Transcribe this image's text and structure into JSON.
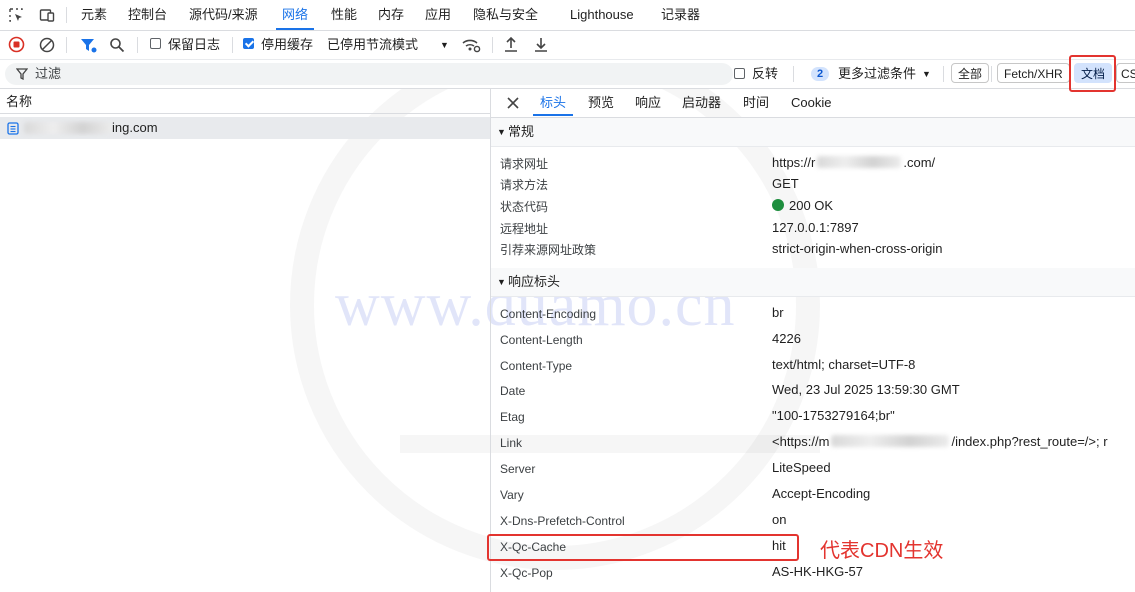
{
  "top_tabs": [
    "元素",
    "控制台",
    "源代码/来源",
    "网络",
    "性能",
    "内存",
    "应用",
    "隐私与安全",
    "Lighthouse",
    "记录器"
  ],
  "active_top_tab": "网络",
  "toolbar": {
    "preserve_log": "保留日志",
    "disable_cache": "停用缓存",
    "throttle": "已停用节流模式"
  },
  "filter": {
    "label": "过滤",
    "invert": "反转",
    "more_count": "2",
    "more_filters": "更多过滤条件",
    "types": [
      "全部",
      "Fetch/XHR",
      "文档",
      "CS"
    ],
    "active_type": "文档"
  },
  "request_list": {
    "column": "名称",
    "rows": [
      {
        "name_suffix": "ing.com"
      }
    ]
  },
  "detail_tabs": [
    "标头",
    "预览",
    "响应",
    "启动器",
    "时间",
    "Cookie"
  ],
  "active_detail_tab": "标头",
  "general": {
    "title": "常规",
    "rows": [
      {
        "key": "请求网址",
        "val_prefix": "https://r",
        "val_suffix": ".com/"
      },
      {
        "key": "请求方法",
        "val": "GET"
      },
      {
        "key": "状态代码",
        "val": "200 OK"
      },
      {
        "key": "远程地址",
        "val": "127.0.0.1:7897"
      },
      {
        "key": "引荐来源网址政策",
        "val": "strict-origin-when-cross-origin"
      }
    ]
  },
  "response_headers": {
    "title": "响应标头",
    "rows": [
      {
        "key": "Content-Encoding",
        "val": "br"
      },
      {
        "key": "Content-Length",
        "val": "4226"
      },
      {
        "key": "Content-Type",
        "val": "text/html; charset=UTF-8"
      },
      {
        "key": "Date",
        "val": "Wed, 23 Jul 2025 13:59:30 GMT"
      },
      {
        "key": "Etag",
        "val": "\"100-1753279164;br\""
      },
      {
        "key": "Link",
        "val_prefix": "<https://m",
        "val_suffix": "/index.php?rest_route=/>; r"
      },
      {
        "key": "Server",
        "val": "LiteSpeed"
      },
      {
        "key": "Vary",
        "val": "Accept-Encoding"
      },
      {
        "key": "X-Dns-Prefetch-Control",
        "val": "on"
      },
      {
        "key": "X-Qc-Cache",
        "val": "hit"
      },
      {
        "key": "X-Qc-Pop",
        "val": "AS-HK-HKG-57"
      }
    ]
  },
  "annotation": "代表CDN生效",
  "watermark": "www.duamo.cn",
  "colors": {
    "accent": "#1a73e8",
    "highlight": "#e3342f",
    "status_ok": "#1e8e3e"
  }
}
